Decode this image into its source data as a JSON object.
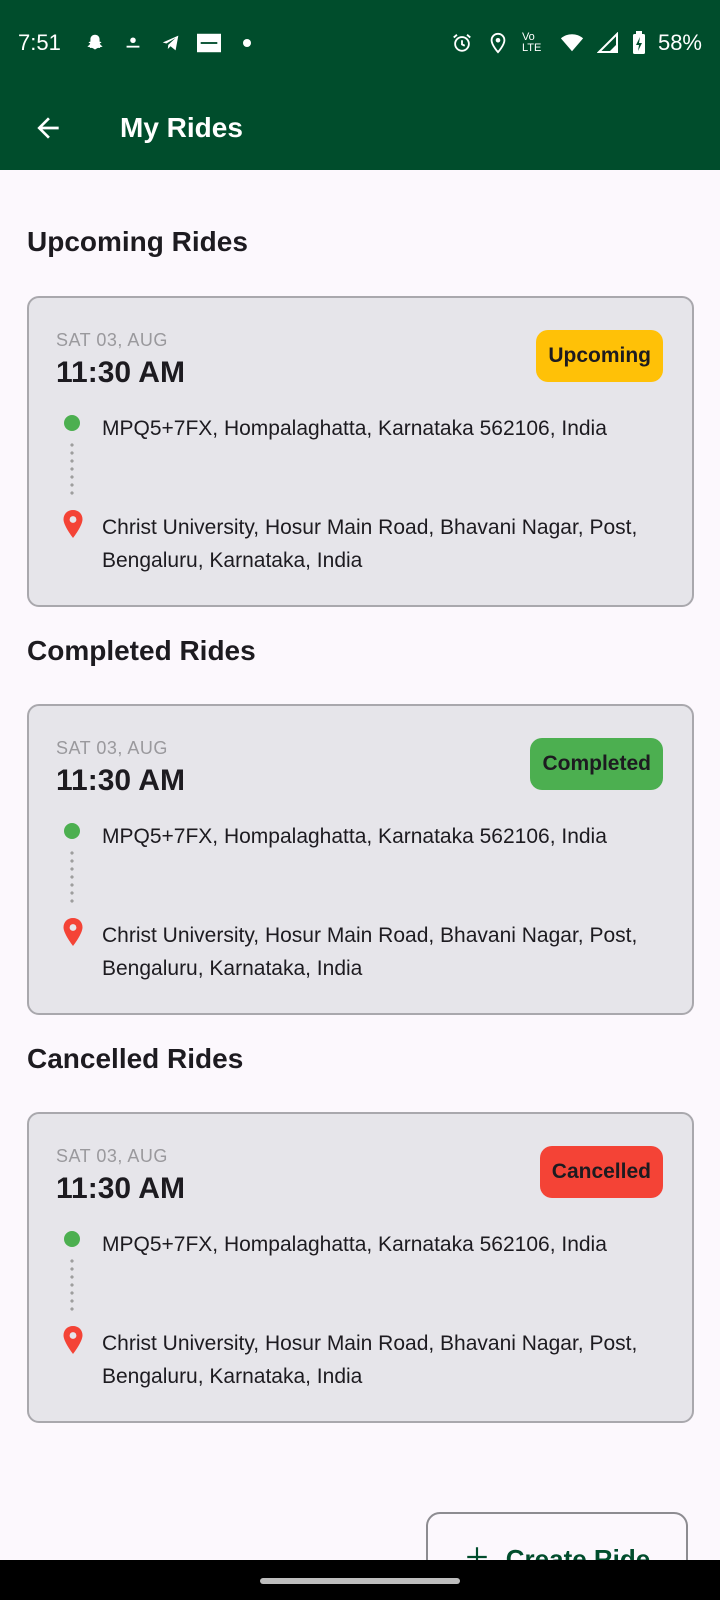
{
  "status_bar": {
    "time": "7:51",
    "battery": "58%",
    "network_label": "Vo LTE",
    "left_icons": [
      "snapchat-icon",
      "app-icon",
      "telegram-icon",
      "news-icon",
      "dot-icon"
    ],
    "right_icons": [
      "alarm-icon",
      "location-icon",
      "volte-icon",
      "wifi-icon",
      "signal-icon",
      "battery-icon"
    ]
  },
  "app_bar": {
    "title": "My Rides",
    "back_icon": "arrow-back-icon"
  },
  "sections": [
    {
      "title": "Upcoming Rides",
      "ride": {
        "date": "SAT 03, AUG",
        "time": "11:30 AM",
        "status": "Upcoming",
        "pickup": "MPQ5+7FX, Hompalaghatta, Karnataka 562106, India",
        "drop": "Christ University, Hosur Main Road, Bhavani Nagar, Post, Bengaluru, Karnataka, India"
      }
    },
    {
      "title": "Completed Rides",
      "ride": {
        "date": "SAT 03, AUG",
        "time": "11:30 AM",
        "status": "Completed",
        "pickup": "MPQ5+7FX, Hompalaghatta, Karnataka 562106, India",
        "drop": "Christ University, Hosur Main Road, Bhavani Nagar, Post, Bengaluru, Karnataka, India"
      }
    },
    {
      "title": "Cancelled Rides",
      "ride": {
        "date": "SAT 03, AUG",
        "time": "11:30 AM",
        "status": "Cancelled",
        "pickup": "MPQ5+7FX, Hompalaghatta, Karnataka 562106, India",
        "drop": "Christ University, Hosur Main Road, Bhavani Nagar, Post, Bengaluru, Karnataka, India"
      }
    }
  ],
  "fab": {
    "label": "Create Ride",
    "icon": "plus-icon"
  },
  "colors": {
    "primary": "#004d2c",
    "upcoming": "#ffc107",
    "completed": "#4caf50",
    "cancelled": "#f44336",
    "pin": "#f44336"
  }
}
